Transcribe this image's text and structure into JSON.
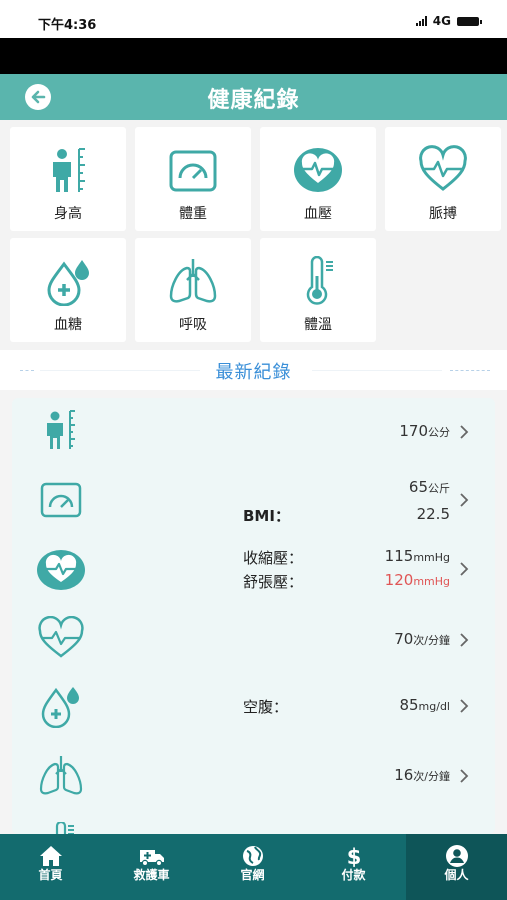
{
  "status_bar": {
    "time": "下午4:36",
    "network": "4G"
  },
  "header": {
    "title": "健康紀錄"
  },
  "categories": [
    {
      "label": "身高",
      "icon": "height-icon"
    },
    {
      "label": "體重",
      "icon": "scale-icon"
    },
    {
      "label": "血壓",
      "icon": "heart-pulse-icon"
    },
    {
      "label": "脈搏",
      "icon": "heartbeat-icon"
    },
    {
      "label": "血糖",
      "icon": "blood-drop-icon"
    },
    {
      "label": "呼吸",
      "icon": "lungs-icon"
    },
    {
      "label": "體溫",
      "icon": "thermometer-icon"
    }
  ],
  "latest": {
    "title": "最新紀錄"
  },
  "records": {
    "height": {
      "value": "170",
      "unit": "公分"
    },
    "weight": {
      "value": "65",
      "unit": "公斤",
      "bmi_label": "BMI：",
      "bmi_value": "22.5"
    },
    "blood_pressure": {
      "systolic_label": "收縮壓：",
      "systolic_value": "115",
      "systolic_unit": "mmHg",
      "diastolic_label": "舒張壓：",
      "diastolic_value": "120",
      "diastolic_unit": "mmHg",
      "alert_color": "#e05555"
    },
    "pulse": {
      "value": "70",
      "unit": "次/分鐘"
    },
    "blood_sugar": {
      "label": "空腹：",
      "value": "85",
      "unit": "mg/dl"
    },
    "respiration": {
      "value": "16",
      "unit": "次/分鐘"
    }
  },
  "tabbar": {
    "items": [
      {
        "label": "首頁",
        "icon": "home-icon"
      },
      {
        "label": "救護車",
        "icon": "ambulance-icon"
      },
      {
        "label": "官網",
        "icon": "globe-icon"
      },
      {
        "label": "付款",
        "icon": "dollar-icon"
      },
      {
        "label": "個人",
        "icon": "user-icon"
      }
    ],
    "active_index": 4
  },
  "colors": {
    "teal": "#5ab5ad",
    "icon_teal": "#3fa9a6",
    "tabbar": "#136b6e",
    "link_blue": "#3a8fd8"
  }
}
